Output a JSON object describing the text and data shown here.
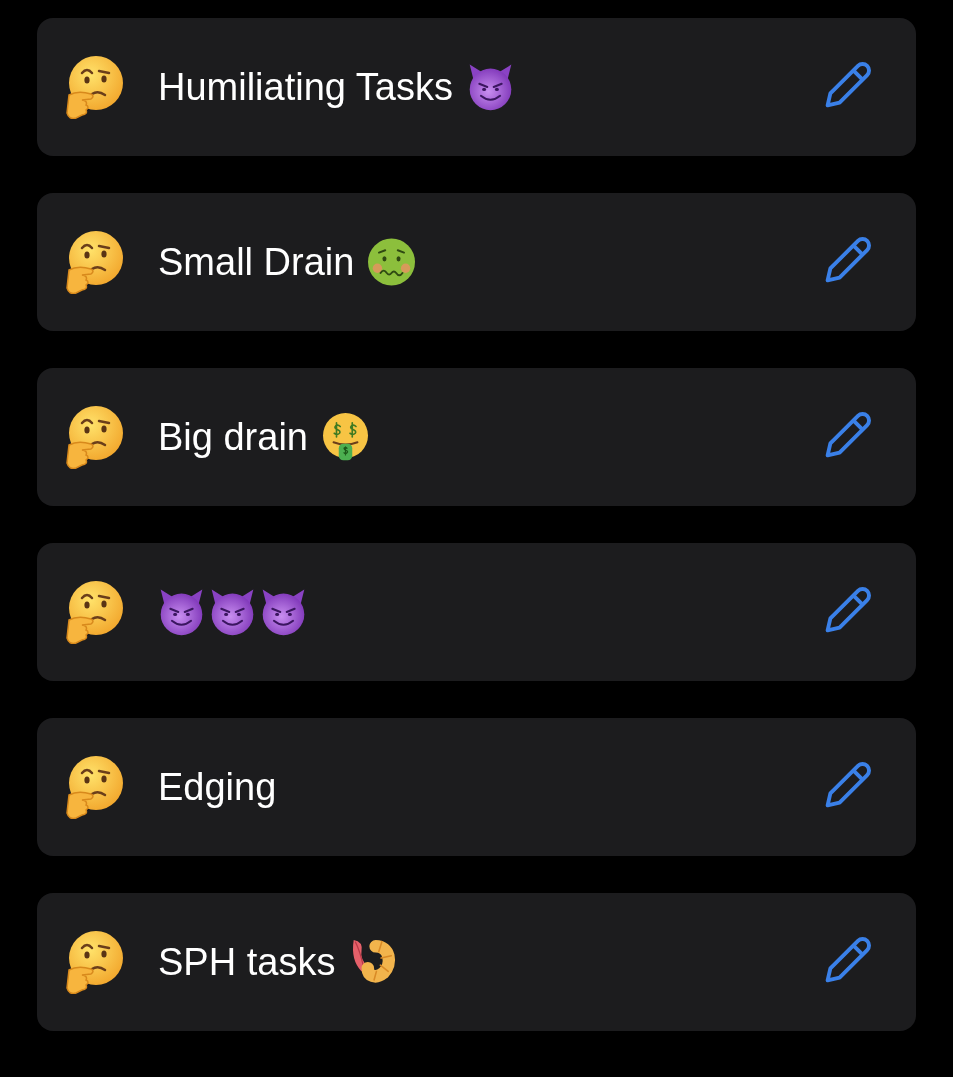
{
  "items": [
    {
      "label": "Humiliating Tasks",
      "trailing_icons": [
        {
          "kind": "devil"
        }
      ]
    },
    {
      "label": "Small Drain",
      "trailing_icons": [
        {
          "kind": "nauseated"
        }
      ]
    },
    {
      "label": "Big drain",
      "trailing_icons": [
        {
          "kind": "money-mouth"
        }
      ]
    },
    {
      "trailing_icons": [
        {
          "kind": "devil"
        },
        {
          "kind": "devil"
        },
        {
          "kind": "devil"
        }
      ]
    },
    {
      "label": "Edging"
    },
    {
      "label": "SPH tasks",
      "trailing_icons": [
        {
          "kind": "shrimp"
        }
      ]
    }
  ]
}
